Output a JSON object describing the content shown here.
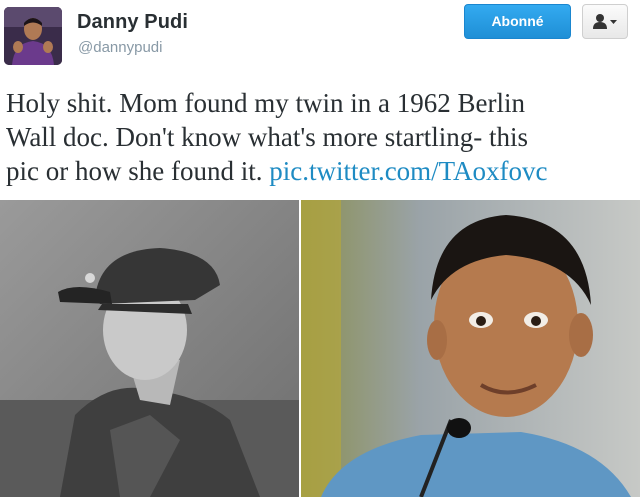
{
  "user": {
    "name": "Danny Pudi",
    "handle": "@dannypudi"
  },
  "actions": {
    "follow_label": "Abonné",
    "user_menu_icon": "person-dropdown-icon"
  },
  "tweet": {
    "line1": "Holy shit. Mom found my twin in a 1962 Berlin",
    "line2": "Wall doc. Don't know what's more startling- this",
    "line3_text": "pic or how she found it. ",
    "link": "pic.twitter.com/TAoxfovc"
  },
  "colors": {
    "follow_button": "#2a9fe6",
    "link": "#1e8bc3",
    "name": "#292f33",
    "handle": "#8899a6"
  }
}
